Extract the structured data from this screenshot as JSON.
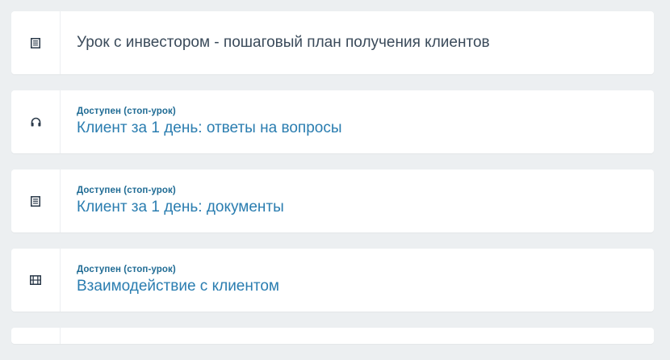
{
  "lessons": [
    {
      "icon": "document-list-icon",
      "status": "",
      "title": "Урок с инвестором - пошаговый план получения клиентов"
    },
    {
      "icon": "headphones-icon",
      "status": "Доступен (стоп-урок)",
      "title": "Клиент за 1 день: ответы на вопросы"
    },
    {
      "icon": "document-list-icon",
      "status": "Доступен (стоп-урок)",
      "title": "Клиент за 1 день: документы"
    },
    {
      "icon": "film-icon",
      "status": "Доступен (стоп-урок)",
      "title": "Взаимодействие с клиентом"
    }
  ],
  "colors": {
    "background": "#eceff1",
    "card": "#ffffff",
    "status_text": "#1f6b94",
    "title_available": "#2a7db0",
    "title_locked": "#3a4a5a",
    "icon": "#2b3a4a"
  }
}
